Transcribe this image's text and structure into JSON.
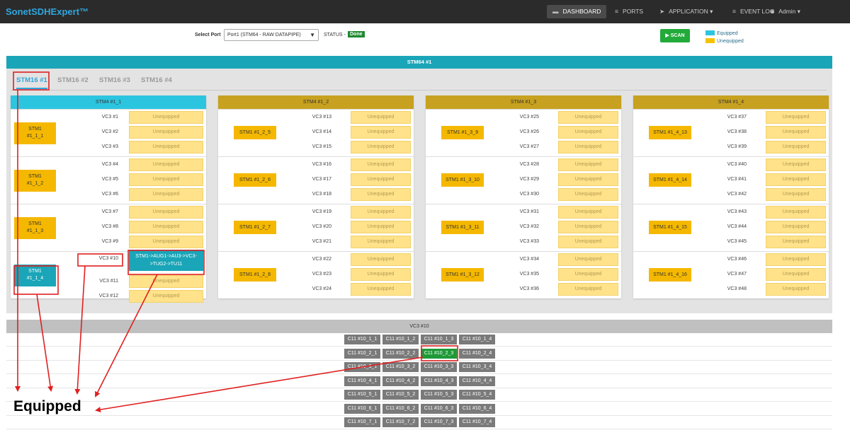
{
  "app": {
    "brand": "SonetSDHExpert™"
  },
  "nav": {
    "dashboard": "DASHBOARD",
    "ports": "PORTS",
    "application": "APPLICATION",
    "event_log": "EVENT LOG",
    "admin": "Admin"
  },
  "toolbar": {
    "select_label": "Select Port",
    "port_value": "Port1 (STM64 - RAW DATAPIPE)",
    "status_label": "STATUS -",
    "status_value": "Done",
    "scan_label": "SCAN"
  },
  "legend": {
    "equipped": "Equipped",
    "unequipped": "Unequipped",
    "equipped_color": "#2cc5e0",
    "unequipped_color": "#f5c200"
  },
  "stm64": {
    "title": "STM64 #1"
  },
  "tabs": [
    "STM16 #1",
    "STM16 #2",
    "STM16 #3",
    "STM16 #4"
  ],
  "stm4_blocks": [
    {
      "title": "STM4 #1_1",
      "groups": [
        {
          "stm1": "STM1\n#1_1_1",
          "vcs": [
            {
              "vc": "VC3 #1",
              "status": "Unequipped"
            },
            {
              "vc": "VC3 #2",
              "status": "Unequipped"
            },
            {
              "vc": "VC3 #3",
              "status": "Unequipped"
            }
          ]
        },
        {
          "stm1": "STM1\n#1_1_2",
          "vcs": [
            {
              "vc": "VC3 #4",
              "status": "Unequipped"
            },
            {
              "vc": "VC3 #5",
              "status": "Unequipped"
            },
            {
              "vc": "VC3 #6",
              "status": "Unequipped"
            }
          ]
        },
        {
          "stm1": "STM1\n#1_1_3",
          "vcs": [
            {
              "vc": "VC3 #7",
              "status": "Unequipped"
            },
            {
              "vc": "VC3 #8",
              "status": "Unequipped"
            },
            {
              "vc": "VC3 #9",
              "status": "Unequipped"
            }
          ]
        },
        {
          "stm1": "STM1\n#1_1_4",
          "vcs": [
            {
              "vc": "VC3 #10",
              "status": "STM1->AUG1->AU3->VC3->TUG2->TU11"
            },
            {
              "vc": "VC3 #11",
              "status": "Unequipped"
            },
            {
              "vc": "VC3 #12",
              "status": "Unequipped"
            }
          ]
        }
      ]
    },
    {
      "title": "STM4 #1_2",
      "groups": [
        {
          "stm1": "STM1 #1_2_5",
          "vcs": [
            {
              "vc": "VC3 #13",
              "status": "Unequipped"
            },
            {
              "vc": "VC3 #14",
              "status": "Unequipped"
            },
            {
              "vc": "VC3 #15",
              "status": "Unequipped"
            }
          ]
        },
        {
          "stm1": "STM1 #1_2_6",
          "vcs": [
            {
              "vc": "VC3 #16",
              "status": "Unequipped"
            },
            {
              "vc": "VC3 #17",
              "status": "Unequipped"
            },
            {
              "vc": "VC3 #18",
              "status": "Unequipped"
            }
          ]
        },
        {
          "stm1": "STM1 #1_2_7",
          "vcs": [
            {
              "vc": "VC3 #19",
              "status": "Unequipped"
            },
            {
              "vc": "VC3 #20",
              "status": "Unequipped"
            },
            {
              "vc": "VC3 #21",
              "status": "Unequipped"
            }
          ]
        },
        {
          "stm1": "STM1 #1_2_8",
          "vcs": [
            {
              "vc": "VC3 #22",
              "status": "Unequipped"
            },
            {
              "vc": "VC3 #23",
              "status": "Unequipped"
            },
            {
              "vc": "VC3 #24",
              "status": "Unequipped"
            }
          ]
        }
      ]
    },
    {
      "title": "STM4 #1_3",
      "groups": [
        {
          "stm1": "STM1 #1_3_9",
          "vcs": [
            {
              "vc": "VC3 #25",
              "status": "Unequipped"
            },
            {
              "vc": "VC3 #26",
              "status": "Unequipped"
            },
            {
              "vc": "VC3 #27",
              "status": "Unequipped"
            }
          ]
        },
        {
          "stm1": "STM1 #1_3_10",
          "vcs": [
            {
              "vc": "VC3 #28",
              "status": "Unequipped"
            },
            {
              "vc": "VC3 #29",
              "status": "Unequipped"
            },
            {
              "vc": "VC3 #30",
              "status": "Unequipped"
            }
          ]
        },
        {
          "stm1": "STM1 #1_3_11",
          "vcs": [
            {
              "vc": "VC3 #31",
              "status": "Unequipped"
            },
            {
              "vc": "VC3 #32",
              "status": "Unequipped"
            },
            {
              "vc": "VC3 #33",
              "status": "Unequipped"
            }
          ]
        },
        {
          "stm1": "STM1 #1_3_12",
          "vcs": [
            {
              "vc": "VC3 #34",
              "status": "Unequipped"
            },
            {
              "vc": "VC3 #35",
              "status": "Unequipped"
            },
            {
              "vc": "VC3 #36",
              "status": "Unequipped"
            }
          ]
        }
      ]
    },
    {
      "title": "STM4 #1_4",
      "groups": [
        {
          "stm1": "STM1 #1_4_13",
          "vcs": [
            {
              "vc": "VC3 #37",
              "status": "Unequipped"
            },
            {
              "vc": "VC3 #38",
              "status": "Unequipped"
            },
            {
              "vc": "VC3 #39",
              "status": "Unequipped"
            }
          ]
        },
        {
          "stm1": "STM1 #1_4_14",
          "vcs": [
            {
              "vc": "VC3 #40",
              "status": "Unequipped"
            },
            {
              "vc": "VC3 #41",
              "status": "Unequipped"
            },
            {
              "vc": "VC3 #42",
              "status": "Unequipped"
            }
          ]
        },
        {
          "stm1": "STM1 #1_4_15",
          "vcs": [
            {
              "vc": "VC3 #43",
              "status": "Unequipped"
            },
            {
              "vc": "VC3 #44",
              "status": "Unequipped"
            },
            {
              "vc": "VC3 #45",
              "status": "Unequipped"
            }
          ]
        },
        {
          "stm1": "STM1 #1_4_16",
          "vcs": [
            {
              "vc": "VC3 #46",
              "status": "Unequipped"
            },
            {
              "vc": "VC3 #47",
              "status": "Unequipped"
            },
            {
              "vc": "VC3 #48",
              "status": "Unequipped"
            }
          ]
        }
      ]
    }
  ],
  "vc3_panel": {
    "title": "VC3 #10",
    "rows": [
      [
        "C11 #10_1_1",
        "C11 #10_1_2",
        "C11 #10_1_3",
        "C11 #10_1_4"
      ],
      [
        "C11 #10_2_1",
        "C11 #10_2_2",
        "C11 #10_2_3",
        "C11 #10_2_4"
      ],
      [
        "C11 #10_3_1",
        "C11 #10_3_2",
        "C11 #10_3_3",
        "C11 #10_3_4"
      ],
      [
        "C11 #10_4_1",
        "C11 #10_4_2",
        "C11 #10_4_3",
        "C11 #10_4_4"
      ],
      [
        "C11 #10_5_1",
        "C11 #10_5_2",
        "C11 #10_5_3",
        "C11 #10_5_4"
      ],
      [
        "C11 #10_6_1",
        "C11 #10_6_2",
        "C11 #10_6_3",
        "C11 #10_6_4"
      ],
      [
        "C11 #10_7_1",
        "C11 #10_7_2",
        "C11 #10_7_3",
        "C11 #10_7_4"
      ]
    ],
    "equipped_cell": "C11 #10_2_3"
  },
  "annotation": {
    "caption": "Equipped",
    "color": "#e02020"
  }
}
